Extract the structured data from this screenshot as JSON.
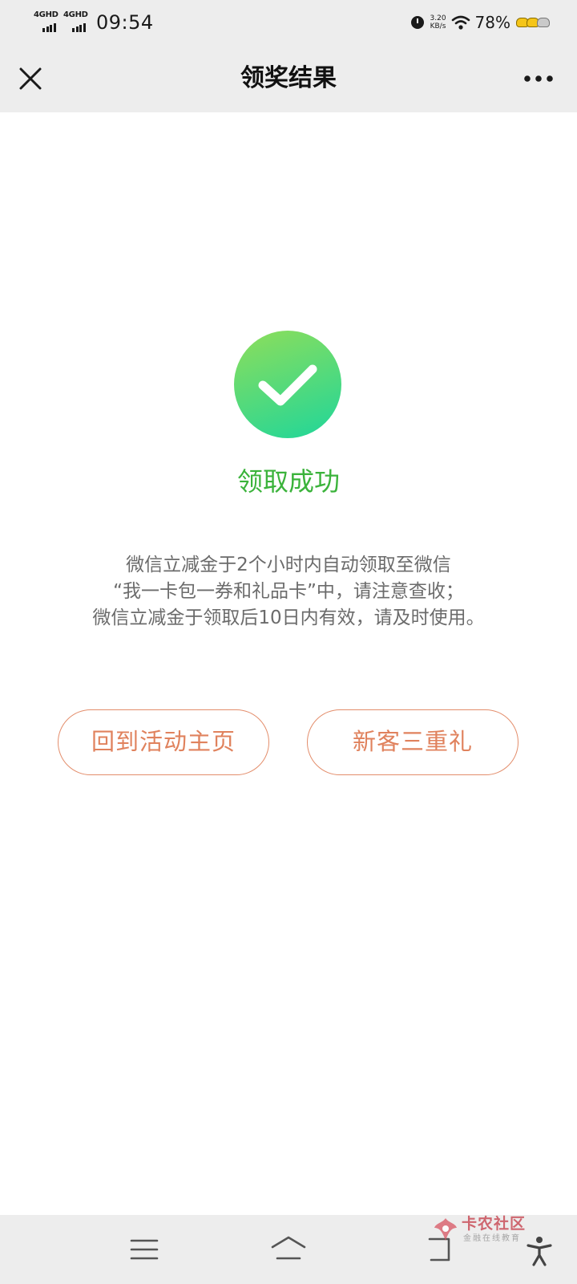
{
  "status_bar": {
    "network_1": "4GHD",
    "network_2": "4GHD",
    "time": "09:54",
    "speed_value": "3.20",
    "speed_unit": "KB/s",
    "battery": "78%"
  },
  "header": {
    "title": "领奖结果",
    "close_icon": "close-icon",
    "more_icon": "more-icon"
  },
  "result": {
    "icon": "check-circle-icon",
    "title": "领取成功",
    "notice_lines": [
      "微信立减金于2个小时内自动领取至微信",
      "“我一卡包一券和礼品卡”中，请注意查收；",
      "微信立减金于领取后10日内有效，请及时使用。"
    ]
  },
  "actions": {
    "home_label": "回到活动主页",
    "gift_label": "新客三重礼"
  },
  "watermark": {
    "name": "卡农社区",
    "subtitle": "金融在线教育"
  },
  "colors": {
    "accent_green": "#3bb33b",
    "button_orange": "#e0825d",
    "bar_grey": "#ededed"
  }
}
